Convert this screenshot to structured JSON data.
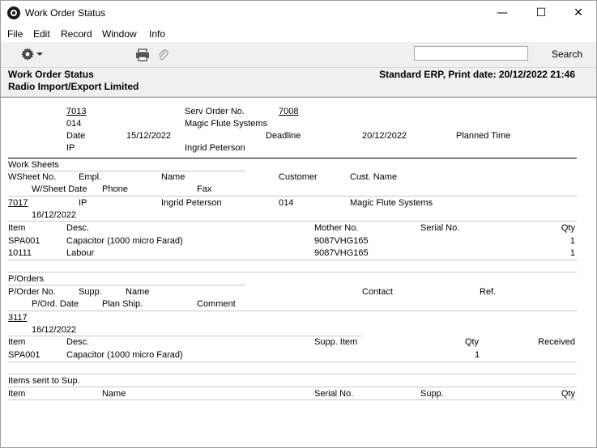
{
  "window": {
    "title": "Work Order Status",
    "controls": {
      "minimize": "—",
      "maximize": "☐",
      "close": "✕"
    }
  },
  "menu": [
    "File",
    "Edit",
    "Record",
    "Window",
    "Info"
  ],
  "toolbar": {
    "search_value": "",
    "search_label": "Search",
    "icons": [
      "gear-icon",
      "printer-icon",
      "paperclip-icon"
    ]
  },
  "report_header": {
    "title": "Work Order Status",
    "company": "Radio Import/Export Limited",
    "right": "Standard ERP, Print date: 20/12/2022 21:46"
  },
  "work_order": {
    "number": "7013",
    "serv_order_label": "Serv Order No.",
    "serv_order_value": "7008",
    "customer_code": "014",
    "customer_name": "Magic Flute Systems",
    "date_label": "Date",
    "date_value": "15/12/2022",
    "deadline_label": "Deadline",
    "deadline_value": "20/12/2022",
    "planned_time_label": "Planned Time",
    "person_code": "IP",
    "person_name": "Ingrid Peterson"
  },
  "work_sheets": {
    "section_label": "Work Sheets",
    "headers": {
      "wsheet_no": "WSheet No.",
      "empl": "Empl.",
      "name": "Name",
      "customer": "Customer",
      "cust_name": "Cust. Name",
      "wsheet_date": "W/Sheet Date",
      "phone": "Phone",
      "fax": "Fax"
    },
    "row": {
      "number": "7017",
      "empl": "IP",
      "name": "Ingrid Peterson",
      "customer": "014",
      "cust_name": "Magic Flute Systems",
      "date": "16/12/2022"
    },
    "item_headers": {
      "item": "Item",
      "desc": "Desc.",
      "mother_no": "Mother No.",
      "serial_no": "Serial No.",
      "qty": "Qty"
    },
    "items": [
      {
        "item": "SPA001",
        "desc": "Capacitor (1000 micro Farad)",
        "mother_no": "9087VHG165",
        "serial_no": "",
        "qty": "1"
      },
      {
        "item": "10111",
        "desc": "Labour",
        "mother_no": "9087VHG165",
        "serial_no": "",
        "qty": "1"
      }
    ]
  },
  "purchase_orders": {
    "section_label": "P/Orders",
    "headers": {
      "porder_no": "P/Order No.",
      "supp": "Supp.",
      "name": "Name",
      "contact": "Contact",
      "ref": "Ref.",
      "pord_date": "P/Ord. Date",
      "plan_ship": "Plan Ship.",
      "comment": "Comment"
    },
    "row": {
      "number": "3117",
      "date": "16/12/2022"
    },
    "item_headers": {
      "item": "Item",
      "desc": "Desc.",
      "supp_item": "Supp. Item",
      "qty": "Qty",
      "received": "Received"
    },
    "items": [
      {
        "item": "SPA001",
        "desc": "Capacitor (1000 micro Farad)",
        "supp_item": "",
        "qty": "1",
        "received": ""
      }
    ]
  },
  "items_sent": {
    "section_label": "Items sent to Sup.",
    "headers": {
      "item": "Item",
      "name": "Name",
      "serial_no": "Serial No.",
      "supp": "Supp.",
      "qty": "Qty"
    }
  }
}
